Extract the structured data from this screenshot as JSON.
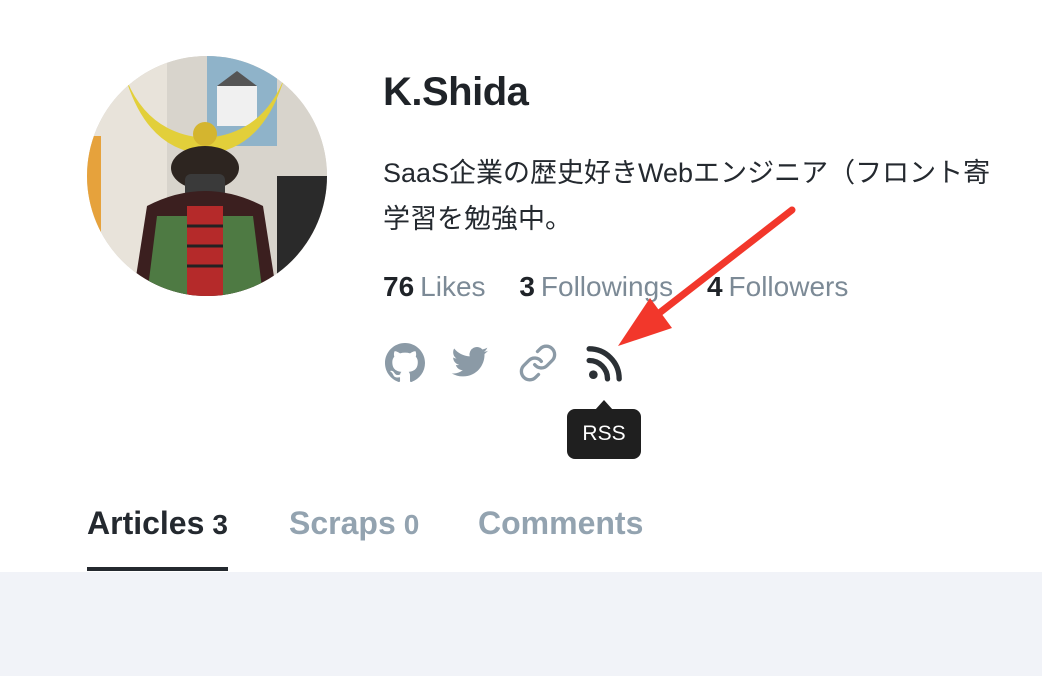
{
  "profile": {
    "name": "K.Shida",
    "bio_line1": "SaaS企業の歴史好きWebエンジニア（フロント寄",
    "bio_line2": "学習を勉強中。"
  },
  "stats": [
    {
      "count": "76",
      "label": "Likes"
    },
    {
      "count": "3",
      "label": "Followings"
    },
    {
      "count": "4",
      "label": "Followers"
    }
  ],
  "social_icons": [
    "github-icon",
    "twitter-icon",
    "link-icon",
    "rss-icon"
  ],
  "tooltip": {
    "text": "RSS"
  },
  "tabs": [
    {
      "label": "Articles",
      "count": "3",
      "active": true
    },
    {
      "label": "Scraps",
      "count": "0",
      "active": false
    },
    {
      "label": "Comments",
      "count": "",
      "active": false
    }
  ],
  "colors": {
    "text_primary": "#24292f",
    "text_muted": "#93a3b0",
    "icon_gray": "#8b9aa6",
    "tooltip_bg": "#1f1f1f",
    "annotation_arrow": "#f2372b",
    "content_bg": "#f1f3f8"
  }
}
